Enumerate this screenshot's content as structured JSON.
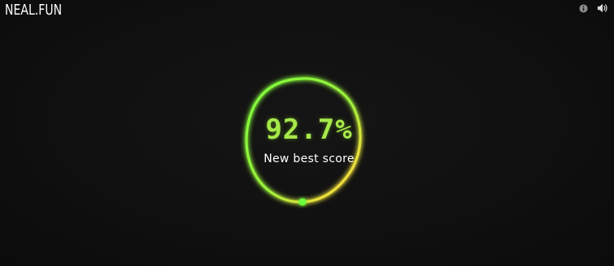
{
  "header": {
    "logo": "NEAL.FUN",
    "icons": [
      "info-icon",
      "speaker-icon"
    ]
  },
  "game": {
    "score": "92.7%",
    "status": "New best score",
    "accuracy_percent": 92.7,
    "colors": {
      "gradient_top": "#7cff3a",
      "gradient_bottom_right": "#ffd23a",
      "score_text": "#a6e84a",
      "background": "#101010"
    }
  }
}
